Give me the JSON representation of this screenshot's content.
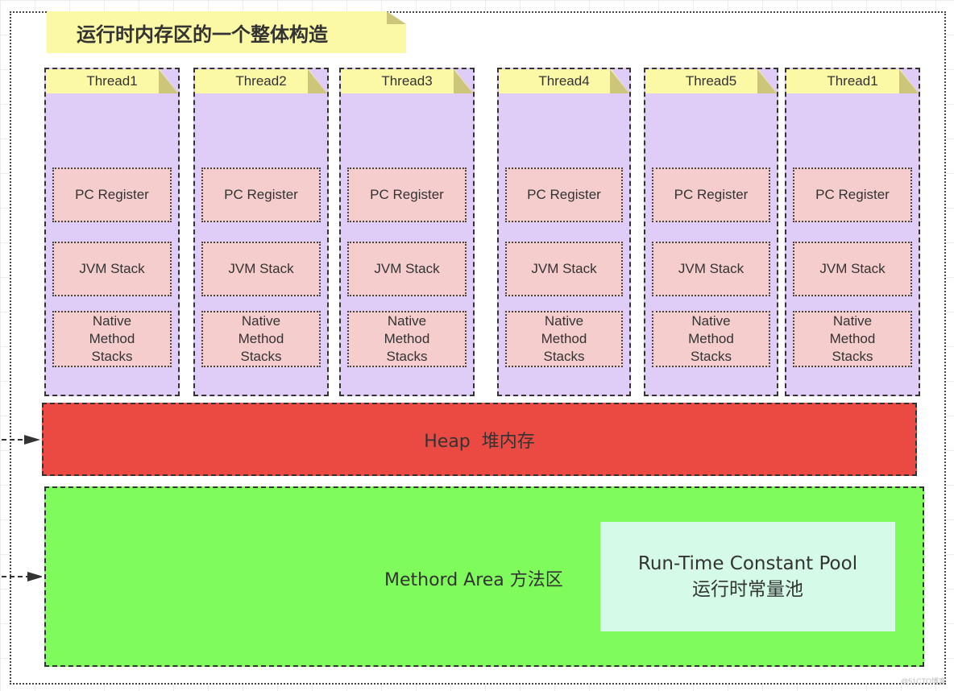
{
  "title": "运行时内存区的一个整体构造",
  "threads": [
    {
      "label": "Thread1",
      "regions": [
        "PC Register",
        "JVM Stack",
        "Native Method Stacks"
      ]
    },
    {
      "label": "Thread2",
      "regions": [
        "PC Register",
        "JVM Stack",
        "Native Method Stacks"
      ]
    },
    {
      "label": "Thread3",
      "regions": [
        "PC Register",
        "JVM Stack",
        "Native Method Stacks"
      ]
    },
    {
      "label": "Thread4",
      "regions": [
        "PC Register",
        "JVM Stack",
        "Native Method Stacks"
      ]
    },
    {
      "label": "Thread5",
      "regions": [
        "PC Register",
        "JVM Stack",
        "Native Method Stacks"
      ]
    },
    {
      "label": "Thread1",
      "regions": [
        "PC Register",
        "JVM Stack",
        "Native Method Stacks"
      ]
    }
  ],
  "heap": {
    "label": "Heap  堆内存",
    "color": "#eb4a43"
  },
  "method_area": {
    "label": "Methord Area 方法区",
    "color": "#7ffb5b",
    "constant_pool": {
      "line1": "Run-Time Constant Pool",
      "line2": "运行时常量池",
      "color": "#d5fbe8"
    }
  },
  "colors": {
    "thread_bg": "#dfcdf8",
    "note_yellow": "#fbf8a6",
    "region_pink": "#f6cdcd"
  },
  "watermark": "@51CTO博客"
}
